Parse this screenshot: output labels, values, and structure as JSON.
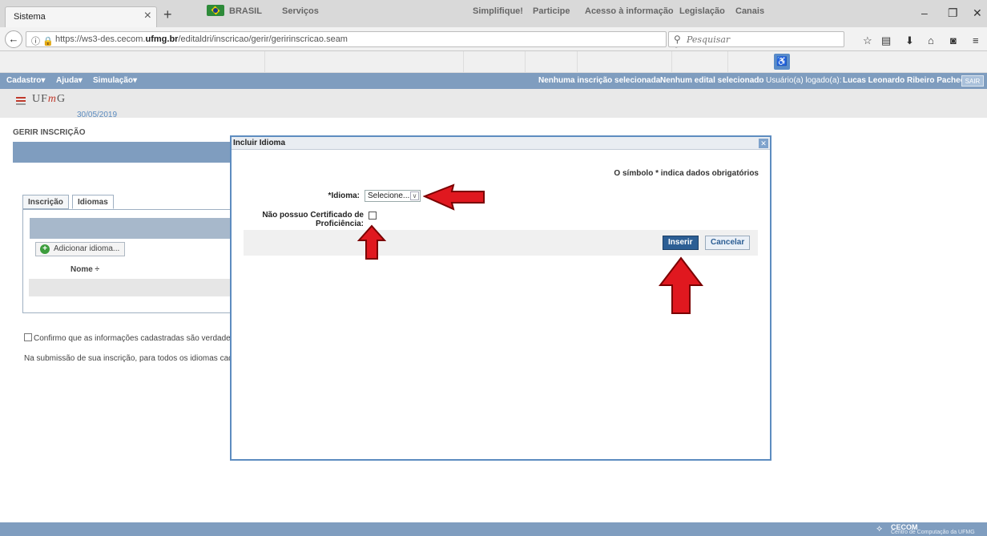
{
  "browser": {
    "tab_title": "Sistema",
    "url_host_prefix": "https://ws3-des.cecom.",
    "url_host_bold": "ufmg.br",
    "url_path": "/editaldri/inscricao/gerir/geririnscricao.seam",
    "search_placeholder": "Pesquisar"
  },
  "govbar": {
    "brasil": "BRASIL",
    "servicos": "Serviços",
    "links": [
      "Simplifique!",
      "Participe",
      "Acesso à informação",
      "Legislação",
      "Canais"
    ]
  },
  "menubar": {
    "items": [
      "Cadastro▾",
      "Ajuda▾",
      "Simulação▾"
    ],
    "inscricao_status": "Nenhuma inscrição selecionada",
    "edital_status": "Nenhum edital selecionado",
    "user_label": "Usuário(a) logado(a):",
    "user_name": "Lucas Leonardo Ribeiro Pacheco",
    "sair": "SAIR",
    "separator": "::"
  },
  "header": {
    "logo_text_pre": "UF",
    "logo_text_m": "m",
    "logo_text_post": "G",
    "date": "30/05/2019"
  },
  "page": {
    "title": "GERIR INSCRIÇÃO",
    "tabs": [
      "Inscrição",
      "Idiomas"
    ],
    "add_button": "Adicionar idioma...",
    "column_nome": "Nome ÷",
    "confirm_text": "Confirmo que as informações cadastradas são verdadeir",
    "submission_text": "Na submissão de sua inscrição, para todos os idiomas cada"
  },
  "modal": {
    "title": "Incluir Idioma",
    "required_note": "O símbolo * indica dados obrigatórios",
    "idioma_label": "*Idioma:",
    "idioma_value": "Selecione...",
    "cert_label_line1": "Não possuo Certificado de",
    "cert_label_line2": "Proficiência:",
    "inserir": "Inserir",
    "cancelar": "Cancelar"
  },
  "footer": {
    "cecom": "CECOM",
    "cecom_sub": "Centro de Computação da UFMG"
  },
  "colors": {
    "menubar": "#7f9dbf",
    "arrow_red": "#e0181f",
    "primary_button": "#2c5e94"
  }
}
